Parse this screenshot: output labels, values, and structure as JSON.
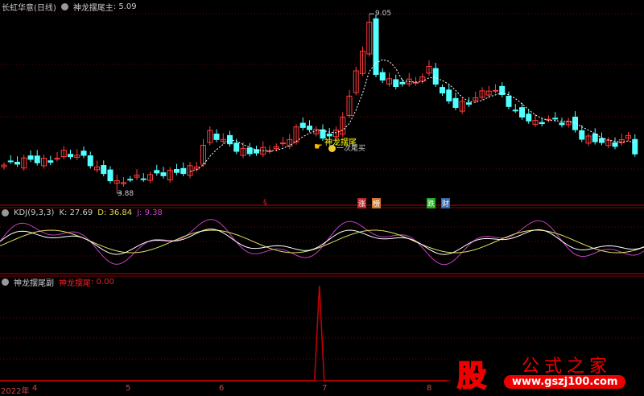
{
  "main_panel": {
    "stock": "长虹华意(日线)",
    "indicator": "神龙摆尾主",
    "value": ": 5.09",
    "high_label": "9.05",
    "low_label": "3.88",
    "signal_label": "神龙摆尾",
    "buy_label": "一次尾买"
  },
  "markers": [
    {
      "text": "涨",
      "color": "#b22"
    },
    {
      "text": "榜",
      "color": "#c73"
    },
    {
      "text": "跌",
      "color": "#2a2"
    },
    {
      "text": "财",
      "color": "#36a"
    }
  ],
  "kdj_panel": {
    "name": "KDJ(9,3,3)",
    "k": "K: 27.69",
    "d": "D: 36.84",
    "j": "J: 9.38"
  },
  "sub_panel": {
    "name": "神龙摆尾副",
    "series": "神龙摆尾",
    "value": ": 0.00"
  },
  "x_axis": {
    "year": "2022年",
    "months": [
      "4",
      "5",
      "6",
      "7",
      "8"
    ]
  },
  "watermark": {
    "char": "股",
    "title": "公式之家",
    "url": "www.gszj100.com"
  },
  "colors": {
    "up": "#ff3c3c",
    "down": "#54ffff",
    "k": "#ffffff",
    "d": "#e0e060",
    "j": "#c040c0",
    "grid": "#800000"
  },
  "chart_data": {
    "type": "candlestick",
    "anchors": [
      [
        0,
        4.69
      ],
      [
        3,
        4.85
      ],
      [
        7,
        4.8
      ],
      [
        9,
        5.04
      ],
      [
        12,
        4.92
      ],
      [
        14,
        4.58
      ],
      [
        17,
        4.16
      ],
      [
        19,
        4.3
      ],
      [
        22,
        4.39
      ],
      [
        24,
        4.46
      ],
      [
        27,
        4.5
      ],
      [
        29,
        4.69
      ],
      [
        30,
        5.27
      ],
      [
        31,
        5.62
      ],
      [
        33,
        5.39
      ],
      [
        35,
        5.16
      ],
      [
        37,
        5.04
      ],
      [
        40,
        5.16
      ],
      [
        42,
        5.27
      ],
      [
        44,
        5.74
      ],
      [
        46,
        5.78
      ],
      [
        48,
        5.5
      ],
      [
        50,
        5.62
      ],
      [
        52,
        6.66
      ],
      [
        53,
        7.36
      ],
      [
        55,
        8.75
      ],
      [
        56,
        7.3
      ],
      [
        59,
        7.0
      ],
      [
        61,
        7.1
      ],
      [
        63,
        7.2
      ],
      [
        64,
        7.5
      ],
      [
        66,
        6.7
      ],
      [
        68,
        6.4
      ],
      [
        70,
        6.5
      ],
      [
        73,
        6.9
      ],
      [
        75,
        6.7
      ],
      [
        77,
        6.2
      ],
      [
        80,
        5.9
      ],
      [
        82,
        6.0
      ],
      [
        85,
        5.9
      ],
      [
        87,
        5.5
      ],
      [
        89,
        5.4
      ],
      [
        92,
        5.3
      ],
      [
        94,
        5.5
      ],
      [
        95,
        5.09
      ]
    ],
    "high": 9.05,
    "low": 3.88,
    "spike_index": 47
  }
}
